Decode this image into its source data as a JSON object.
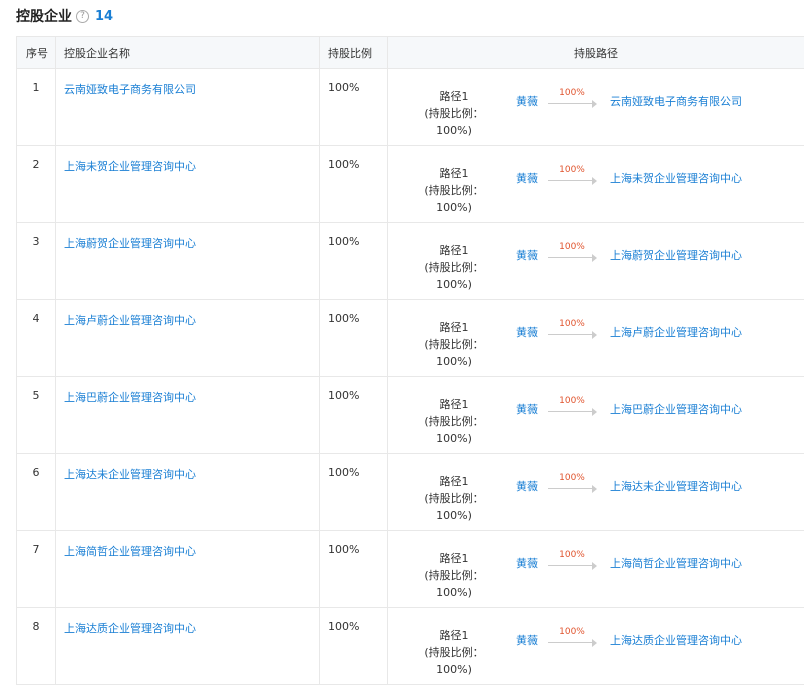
{
  "header": {
    "title": "控股企业",
    "count": "14"
  },
  "columns": {
    "index": "序号",
    "name": "控股企业名称",
    "ratio": "持股比例",
    "path": "持股路径"
  },
  "path_common": {
    "path_name": "路径1",
    "path_ratio": "(持股比例：100%)",
    "person": "黄薇",
    "arrow_pct": "100%"
  },
  "rows": [
    {
      "index": "1",
      "name": "云南娅致电子商务有限公司",
      "ratio": "100%"
    },
    {
      "index": "2",
      "name": "上海未贺企业管理咨询中心",
      "ratio": "100%"
    },
    {
      "index": "3",
      "name": "上海蔚贺企业管理咨询中心",
      "ratio": "100%"
    },
    {
      "index": "4",
      "name": "上海卢蔚企业管理咨询中心",
      "ratio": "100%"
    },
    {
      "index": "5",
      "name": "上海巴蔚企业管理咨询中心",
      "ratio": "100%"
    },
    {
      "index": "6",
      "name": "上海达未企业管理咨询中心",
      "ratio": "100%"
    },
    {
      "index": "7",
      "name": "上海简哲企业管理咨询中心",
      "ratio": "100%"
    },
    {
      "index": "8",
      "name": "上海达质企业管理咨询中心",
      "ratio": "100%"
    }
  ]
}
